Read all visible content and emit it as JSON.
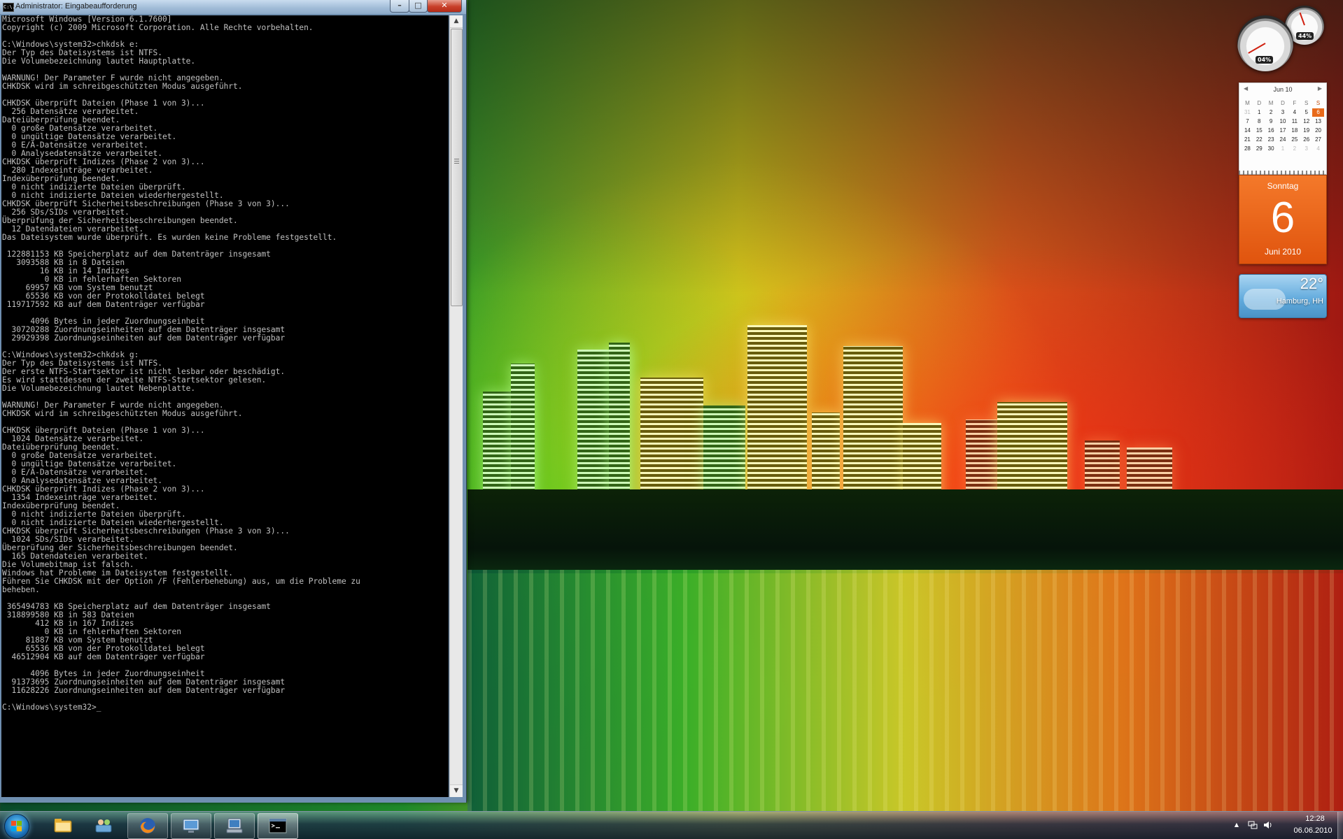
{
  "console": {
    "title": "Administrator: Eingabeaufforderung",
    "title_icon": "C:\\.",
    "buttons": {
      "minimize": "–",
      "maximize": "□",
      "close": "✕"
    },
    "output": "Microsoft Windows [Version 6.1.7600]\nCopyright (c) 2009 Microsoft Corporation. Alle Rechte vorbehalten.\n\nC:\\Windows\\system32>chkdsk e:\nDer Typ des Dateisystems ist NTFS.\nDie Volumebezeichnung lautet Hauptplatte.\n\nWARNUNG! Der Parameter F wurde nicht angegeben.\nCHKDSK wird im schreibgeschützten Modus ausgeführt.\n\nCHKDSK überprüft Dateien (Phase 1 von 3)...\n  256 Datensätze verarbeitet.\nDateiüberprüfung beendet.\n  0 große Datensätze verarbeitet.\n  0 ungültige Datensätze verarbeitet.\n  0 E/A-Datensätze verarbeitet.\n  0 Analysedatensätze verarbeitet.\nCHKDSK überprüft Indizes (Phase 2 von 3)...\n  280 Indexeinträge verarbeitet.\nIndexüberprüfung beendet.\n  0 nicht indizierte Dateien überprüft.\n  0 nicht indizierte Dateien wiederhergestellt.\nCHKDSK überprüft Sicherheitsbeschreibungen (Phase 3 von 3)...\n  256 SDs/SIDs verarbeitet.\nÜberprüfung der Sicherheitsbeschreibungen beendet.\n  12 Datendateien verarbeitet.\nDas Dateisystem wurde überprüft. Es wurden keine Probleme festgestellt.\n\n 122881153 KB Speicherplatz auf dem Datenträger insgesamt\n   3093588 KB in 8 Dateien\n        16 KB in 14 Indizes\n         0 KB in fehlerhaften Sektoren\n     69957 KB vom System benutzt\n     65536 KB von der Protokolldatei belegt\n 119717592 KB auf dem Datenträger verfügbar\n\n      4096 Bytes in jeder Zuordnungseinheit\n  30720288 Zuordnungseinheiten auf dem Datenträger insgesamt\n  29929398 Zuordnungseinheiten auf dem Datenträger verfügbar\n\nC:\\Windows\\system32>chkdsk g:\nDer Typ des Dateisystems ist NTFS.\nDer erste NTFS-Startsektor ist nicht lesbar oder beschädigt.\nEs wird stattdessen der zweite NTFS-Startsektor gelesen.\nDie Volumebezeichnung lautet Nebenplatte.\n\nWARNUNG! Der Parameter F wurde nicht angegeben.\nCHKDSK wird im schreibgeschützten Modus ausgeführt.\n\nCHKDSK überprüft Dateien (Phase 1 von 3)...\n  1024 Datensätze verarbeitet.\nDateiüberprüfung beendet.\n  0 große Datensätze verarbeitet.\n  0 ungültige Datensätze verarbeitet.\n  0 E/A-Datensätze verarbeitet.\n  0 Analysedatensätze verarbeitet.\nCHKDSK überprüft Indizes (Phase 2 von 3)...\n  1354 Indexeinträge verarbeitet.\nIndexüberprüfung beendet.\n  0 nicht indizierte Dateien überprüft.\n  0 nicht indizierte Dateien wiederhergestellt.\nCHKDSK überprüft Sicherheitsbeschreibungen (Phase 3 von 3)...\n  1024 SDs/SIDs verarbeitet.\nÜberprüfung der Sicherheitsbeschreibungen beendet.\n  165 Datendateien verarbeitet.\nDie Volumebitmap ist falsch.\nWindows hat Probleme im Dateisystem festgestellt.\nFühren Sie CHKDSK mit der Option /F (Fehlerbehebung) aus, um die Probleme zu\nbeheben.\n\n 365494783 KB Speicherplatz auf dem Datenträger insgesamt\n 318899580 KB in 583 Dateien\n       412 KB in 167 Indizes\n         0 KB in fehlerhaften Sektoren\n     81887 KB vom System benutzt\n     65536 KB von der Protokolldatei belegt\n  46512904 KB auf dem Datenträger verfügbar\n\n      4096 Bytes in jeder Zuordnungseinheit\n  91373695 Zuordnungseinheiten auf dem Datenträger insgesamt\n  11628226 Zuordnungseinheiten auf dem Datenträger verfügbar\n\nC:\\Windows\\system32>_",
    "scroll_up": "▲",
    "scroll_down": "▼"
  },
  "gadgets": {
    "cpu_meter": {
      "cpu_label": "04%",
      "ram_label": "44%",
      "cpu_percent": 4,
      "ram_percent": 44
    },
    "calendar": {
      "header": "Jun 10",
      "prev": "◀",
      "next": "▶",
      "weekdays": [
        "M",
        "D",
        "M",
        "D",
        "F",
        "S",
        "S"
      ],
      "days": [
        "31",
        "1",
        "2",
        "3",
        "4",
        "5",
        "6",
        "7",
        "8",
        "9",
        "10",
        "11",
        "12",
        "13",
        "14",
        "15",
        "16",
        "17",
        "18",
        "19",
        "20",
        "21",
        "22",
        "23",
        "24",
        "25",
        "26",
        "27",
        "28",
        "29",
        "30",
        "1",
        "2",
        "3",
        "4"
      ],
      "today": "6",
      "weekday_name": "Sonntag",
      "day_number": "6",
      "month_year": "Juni 2010"
    },
    "weather": {
      "temperature": "22°",
      "location": "Hamburg, HH"
    }
  },
  "taskbar": {
    "items": [
      {
        "name": "windows-explorer",
        "state": "pinned"
      },
      {
        "name": "users-network",
        "state": "pinned"
      },
      {
        "name": "firefox",
        "state": "running"
      },
      {
        "name": "remote-desktop",
        "state": "running"
      },
      {
        "name": "computer-management",
        "state": "running"
      },
      {
        "name": "command-prompt",
        "state": "active"
      }
    ],
    "tray": {
      "show_hidden": "▲",
      "time": "12:28",
      "date": "06.06.2010"
    }
  },
  "colors": {
    "console_bg": "#000000",
    "console_fg": "#c0c0c0",
    "calendar_accent": "#e86a1a",
    "titlebar": "#9fbad6"
  }
}
